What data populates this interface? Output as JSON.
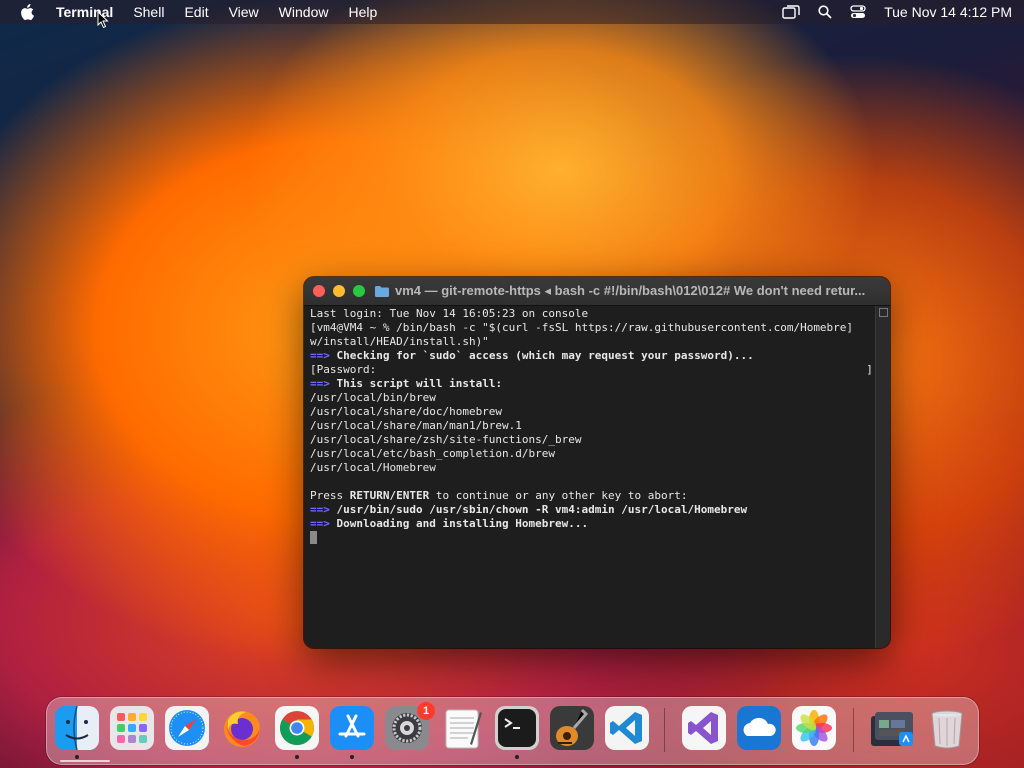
{
  "menubar": {
    "app_name": "Terminal",
    "items": [
      "Shell",
      "Edit",
      "View",
      "Window",
      "Help"
    ],
    "clock": "Tue Nov 14  4:12 PM"
  },
  "terminal": {
    "title": "vm4 — git-remote-https ◂ bash -c #!/bin/bash\\012\\012# We don't need retur...",
    "lines": [
      {
        "prefix": "",
        "text": "Last login: Tue Nov 14 16:05:23 on console",
        "bold": false
      },
      {
        "prefix": "",
        "text": "[vm4@VM4 ~ % /bin/bash -c \"$(curl -fsSL https://raw.githubusercontent.com/Homebre]",
        "bold": false
      },
      {
        "prefix": "",
        "text": "w/install/HEAD/install.sh)\"",
        "bold": false
      },
      {
        "prefix": "==>",
        "text": " Checking for `sudo` access (which may request your password)...",
        "bold": true
      },
      {
        "prefix": "",
        "text": "[Password:                                                                          ]",
        "bold": false
      },
      {
        "prefix": "==>",
        "text": " This script will install:",
        "bold": true
      },
      {
        "prefix": "",
        "text": "/usr/local/bin/brew",
        "bold": false
      },
      {
        "prefix": "",
        "text": "/usr/local/share/doc/homebrew",
        "bold": false
      },
      {
        "prefix": "",
        "text": "/usr/local/share/man/man1/brew.1",
        "bold": false
      },
      {
        "prefix": "",
        "text": "/usr/local/share/zsh/site-functions/_brew",
        "bold": false
      },
      {
        "prefix": "",
        "text": "/usr/local/etc/bash_completion.d/brew",
        "bold": false
      },
      {
        "prefix": "",
        "text": "/usr/local/Homebrew",
        "bold": false
      },
      {
        "prefix": "",
        "text": "",
        "bold": false
      },
      {
        "prefix": "",
        "text": "Press RETURN/ENTER to continue or any other key to abort:",
        "bold": false,
        "bold_part": "RETURN/ENTER"
      },
      {
        "prefix": "==>",
        "text": " /usr/bin/sudo /usr/sbin/chown -R vm4:admin /usr/local/Homebrew",
        "bold": true
      },
      {
        "prefix": "==>",
        "text": " Downloading and installing Homebrew...",
        "bold": true
      }
    ]
  },
  "dock": {
    "items": [
      {
        "name": "finder",
        "icon": "finder-icon",
        "running": true
      },
      {
        "name": "launchpad",
        "icon": "launchpad-icon",
        "running": false
      },
      {
        "name": "safari",
        "icon": "safari-icon",
        "running": false
      },
      {
        "name": "firefox",
        "icon": "firefox-icon",
        "running": false
      },
      {
        "name": "chrome",
        "icon": "chrome-icon",
        "running": true
      },
      {
        "name": "app-store",
        "icon": "app-store-icon",
        "running": true
      },
      {
        "name": "system-settings",
        "icon": "gear-icon",
        "running": false,
        "badge": "1"
      },
      {
        "name": "textedit",
        "icon": "textedit-icon",
        "running": false
      },
      {
        "name": "terminal",
        "icon": "terminal-icon",
        "running": true
      },
      {
        "name": "garageband",
        "icon": "guitar-icon",
        "running": false
      },
      {
        "name": "vscode",
        "icon": "vscode-icon",
        "running": false
      },
      {
        "name": "visual-studio",
        "icon": "visual-studio-icon",
        "running": false
      },
      {
        "name": "onedrive",
        "icon": "cloud-icon",
        "running": false
      },
      {
        "name": "photos",
        "icon": "photos-icon",
        "running": false
      },
      {
        "name": "downloads-stack",
        "icon": "stack-icon",
        "running": false
      },
      {
        "name": "trash",
        "icon": "trash-icon",
        "running": false
      }
    ]
  },
  "colors": {
    "terminal_bg": "#1e1e1e",
    "prompt_arrow": "#6f6fff",
    "close": "#ff5f57",
    "minimize": "#febc2e",
    "zoom": "#28c840",
    "badge": "#ff3b30"
  }
}
